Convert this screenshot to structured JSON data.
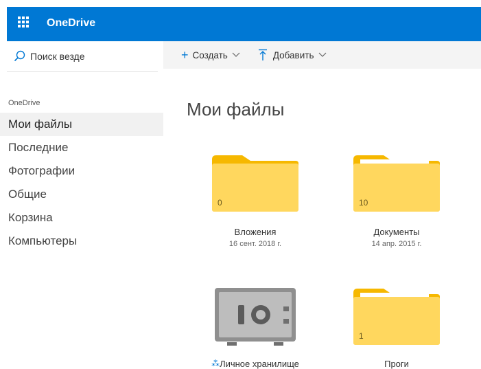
{
  "app": {
    "title": "OneDrive"
  },
  "search": {
    "placeholder": "Поиск везде"
  },
  "nav": {
    "heading": "OneDrive",
    "items": [
      {
        "label": "Мои файлы",
        "active": true
      },
      {
        "label": "Последние"
      },
      {
        "label": "Фотографии"
      },
      {
        "label": "Общие"
      },
      {
        "label": "Корзина"
      },
      {
        "label": "Компьютеры"
      }
    ]
  },
  "commands": {
    "create": "Создать",
    "add": "Добавить"
  },
  "main": {
    "title": "Мои файлы",
    "items": [
      {
        "type": "folder",
        "name": "Вложения",
        "date": "16 сент. 2018 г.",
        "count": "0"
      },
      {
        "type": "folder",
        "name": "Документы",
        "date": "14 апр. 2015 г.",
        "count": "10"
      },
      {
        "type": "vault",
        "name": "Личное хранилище",
        "date": ""
      },
      {
        "type": "folder",
        "name": "Проги",
        "date": "",
        "count": "1"
      }
    ]
  },
  "colors": {
    "brand": "#0078d4",
    "folder": "#ffd75e",
    "folder_tab": "#f6b800"
  }
}
